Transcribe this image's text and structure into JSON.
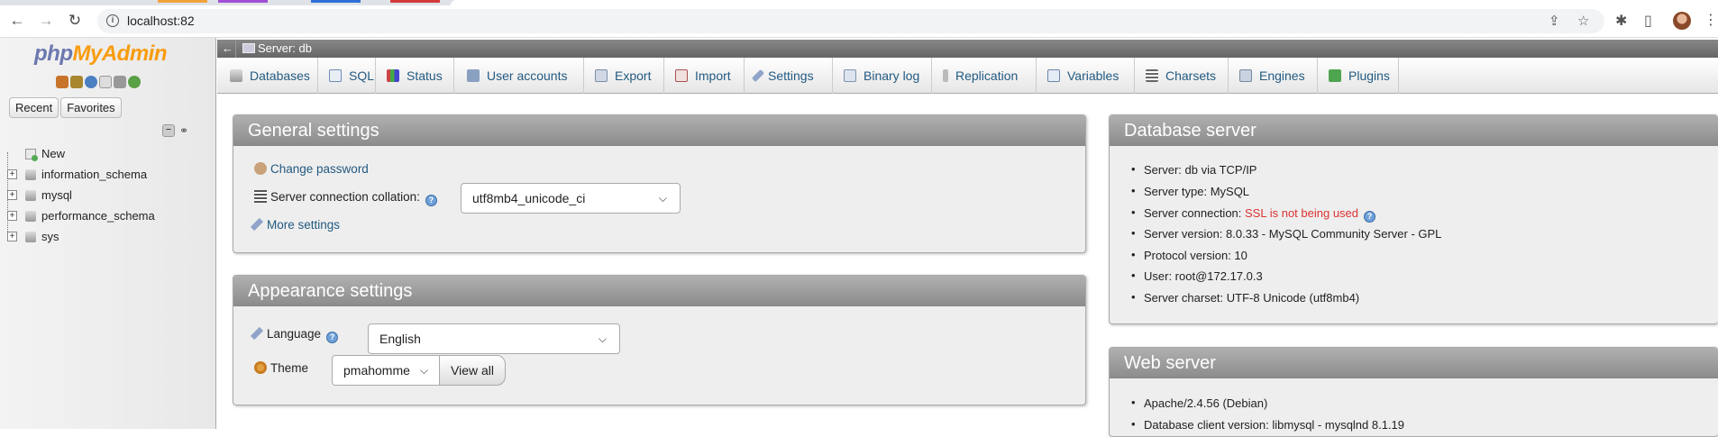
{
  "browser": {
    "url": "localhost:82"
  },
  "sidebar": {
    "logo": {
      "php": "php",
      "my": "My",
      "admin": "Admin"
    },
    "tabs": {
      "recent": "Recent",
      "favorites": "Favorites"
    },
    "tree": [
      {
        "label": "New",
        "kind": "new"
      },
      {
        "label": "information_schema",
        "kind": "db"
      },
      {
        "label": "mysql",
        "kind": "db"
      },
      {
        "label": "performance_schema",
        "kind": "db"
      },
      {
        "label": "sys",
        "kind": "db"
      }
    ]
  },
  "breadcrumb": {
    "arrow": "←",
    "server": "Server: db"
  },
  "menu": {
    "tabs": [
      {
        "label": "Databases",
        "icon": "database-icon"
      },
      {
        "label": "SQL",
        "icon": "sql-icon"
      },
      {
        "label": "Status",
        "icon": "status-icon"
      },
      {
        "label": "User accounts",
        "icon": "users-icon"
      },
      {
        "label": "Export",
        "icon": "export-icon"
      },
      {
        "label": "Import",
        "icon": "import-icon"
      },
      {
        "label": "Settings",
        "icon": "wrench-icon"
      },
      {
        "label": "Binary log",
        "icon": "binlog-icon"
      },
      {
        "label": "Replication",
        "icon": "replication-icon"
      },
      {
        "label": "Variables",
        "icon": "variables-icon"
      },
      {
        "label": "Charsets",
        "icon": "charsets-icon"
      },
      {
        "label": "Engines",
        "icon": "engines-icon"
      },
      {
        "label": "Plugins",
        "icon": "plugins-icon"
      }
    ]
  },
  "general_settings": {
    "title": "General settings",
    "change_password": "Change password",
    "collation_label": "Server connection collation:",
    "collation_value": "utf8mb4_unicode_ci",
    "more_settings": "More settings"
  },
  "appearance_settings": {
    "title": "Appearance settings",
    "language_label": "Language",
    "language_value": "English",
    "theme_label": "Theme",
    "theme_value": "pmahomme",
    "view_all": "View all"
  },
  "database_server": {
    "title": "Database server",
    "items": {
      "server": "Server: db via TCP/IP",
      "type": "Server type: MySQL",
      "connection_prefix": "Server connection: ",
      "connection_status": "SSL is not being used",
      "version": "Server version: 8.0.33 - MySQL Community Server - GPL",
      "protocol": "Protocol version: 10",
      "user": "User: root@172.17.0.3",
      "charset": "Server charset: UTF-8 Unicode (utf8mb4)"
    }
  },
  "web_server": {
    "title": "Web server",
    "items": {
      "apache": "Apache/2.4.56 (Debian)",
      "client": "Database client version: libmysql - mysqlnd 8.1.19"
    }
  },
  "colors": {
    "link": "#235a81",
    "warning": "#dd3333",
    "panel_header": "#9e9e9e"
  }
}
